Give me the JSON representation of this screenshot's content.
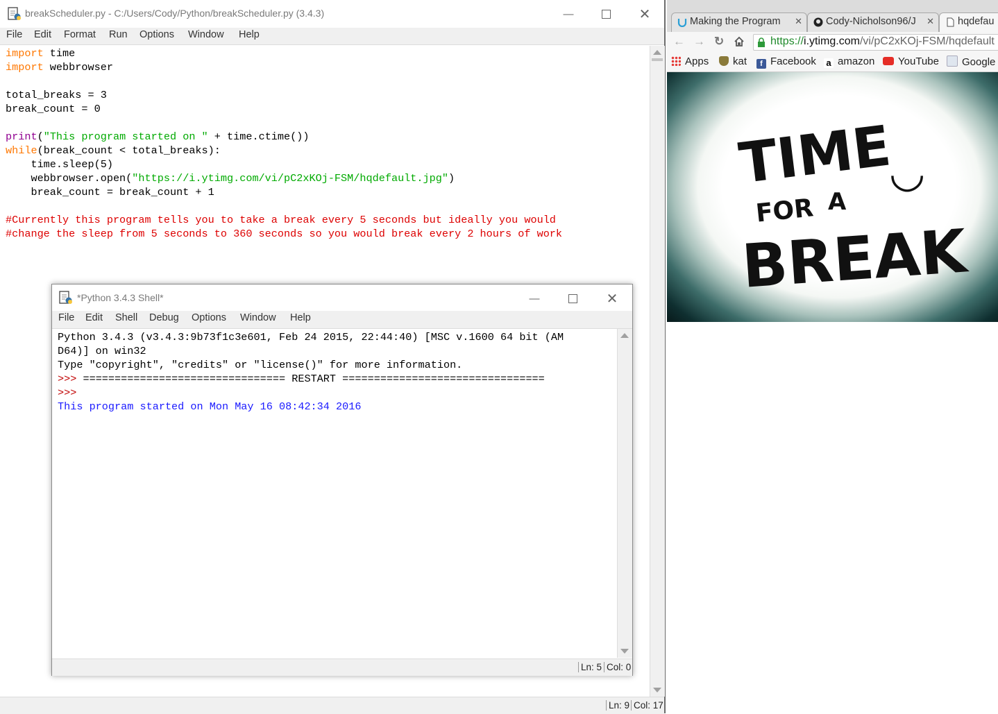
{
  "editor": {
    "title": "breakScheduler.py - C:/Users/Cody/Python/breakScheduler.py (3.4.3)",
    "menu": [
      "File",
      "Edit",
      "Format",
      "Run",
      "Options",
      "Window",
      "Help"
    ],
    "code_lines": [
      [
        {
          "t": "import",
          "c": "kw"
        },
        {
          "t": " time",
          "c": "plain"
        }
      ],
      [
        {
          "t": "import",
          "c": "kw"
        },
        {
          "t": " webbrowser",
          "c": "plain"
        }
      ],
      [],
      [
        {
          "t": "total_breaks = 3",
          "c": "plain"
        }
      ],
      [
        {
          "t": "break_count = 0",
          "c": "plain"
        }
      ],
      [],
      [
        {
          "t": "print",
          "c": "bi"
        },
        {
          "t": "(",
          "c": "plain"
        },
        {
          "t": "\"This program started on \"",
          "c": "str"
        },
        {
          "t": " + time.ctime())",
          "c": "plain"
        }
      ],
      [
        {
          "t": "while",
          "c": "kw"
        },
        {
          "t": "(break_count < total_breaks):",
          "c": "plain"
        }
      ],
      [
        {
          "t": "    time.sleep(5)",
          "c": "plain"
        }
      ],
      [
        {
          "t": "    webbrowser.open(",
          "c": "plain"
        },
        {
          "t": "\"https://i.ytimg.com/vi/pC2xKOj-FSM/hqdefault.jpg\"",
          "c": "str"
        },
        {
          "t": ")",
          "c": "plain"
        }
      ],
      [
        {
          "t": "    break_count = break_count + 1",
          "c": "plain"
        }
      ],
      [],
      [
        {
          "t": "#Currently this program tells you to take a break every 5 seconds but ideally you would",
          "c": "cm"
        }
      ],
      [
        {
          "t": "#change the sleep from 5 seconds to 360 seconds so you would break every 2 hours of work",
          "c": "cm"
        }
      ]
    ],
    "status": {
      "line": "Ln: 9",
      "col": "Col: 17"
    }
  },
  "shell": {
    "title": "*Python 3.4.3 Shell*",
    "menu": [
      "File",
      "Edit",
      "Shell",
      "Debug",
      "Options",
      "Window",
      "Help"
    ],
    "lines": [
      [
        {
          "t": "Python 3.4.3 (v3.4.3:9b73f1c3e601, Feb 24 2015, 22:44:40) [MSC v.1600 64 bit (AM",
          "c": "plain"
        }
      ],
      [
        {
          "t": "D64)] on win32",
          "c": "plain"
        }
      ],
      [
        {
          "t": "Type \"copyright\", \"credits\" or \"license()\" for more information.",
          "c": "plain"
        }
      ],
      [
        {
          "t": ">>> ",
          "c": "sh-prompt"
        },
        {
          "t": "================================ RESTART ================================",
          "c": "plain"
        }
      ],
      [
        {
          "t": ">>> ",
          "c": "sh-prompt"
        }
      ],
      [
        {
          "t": "This program started on Mon May 16 08:42:34 2016",
          "c": "sh-out"
        }
      ]
    ],
    "status": {
      "line": "Ln: 5",
      "col": "Col: 0"
    }
  },
  "browser": {
    "tabs": [
      {
        "label": "Making the Program",
        "active": false
      },
      {
        "label": "Cody-Nicholson96/J",
        "active": false
      },
      {
        "label": "hqdefau",
        "active": true
      }
    ],
    "url": {
      "scheme": "https://",
      "host": "i.ytimg.com",
      "path": "/vi/pC2xKOj-FSM/hqdefault"
    },
    "bookmarks": [
      "Apps",
      "kat",
      "Facebook",
      "amazon",
      "YouTube",
      "Google"
    ],
    "image_text": {
      "line1": "TIME",
      "smiley": "◡",
      "line2a": "FOR",
      "line2b": "A",
      "line3": "BREAK"
    }
  },
  "colors": {
    "keyword": "#ff7700",
    "string": "#00aa00",
    "builtin": "#900090",
    "comment": "#dd0000",
    "shell_output": "#1a1aff",
    "prompt": "#c00000"
  }
}
